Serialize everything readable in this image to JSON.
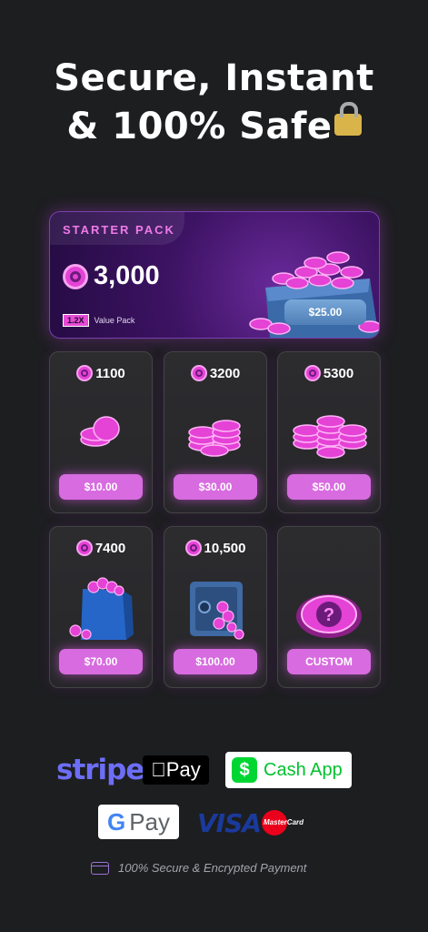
{
  "hero": {
    "line1": "Secure, Instant",
    "line2": "& 100% Safe"
  },
  "starter_pack": {
    "title": "STARTER PACK",
    "amount": "3,000",
    "multiplier": "1.2X",
    "badge_label": "Value Pack",
    "price": "$25.00"
  },
  "packs": [
    {
      "amount": "1100",
      "price": "$10.00",
      "art": "coin-pile-small-icon"
    },
    {
      "amount": "3200",
      "price": "$30.00",
      "art": "coin-pile-medium-icon"
    },
    {
      "amount": "5300",
      "price": "$50.00",
      "art": "coin-pile-large-icon"
    },
    {
      "amount": "7400",
      "price": "$70.00",
      "art": "shopping-bag-icon"
    },
    {
      "amount": "10,500",
      "price": "$100.00",
      "art": "safe-vault-icon"
    },
    {
      "amount": "",
      "price": "CUSTOM",
      "art": "question-coin-icon"
    }
  ],
  "payments": {
    "stripe": "stripe",
    "apple_pay": "Pay",
    "cash_app": "Cash App",
    "google_pay": "Pay",
    "visa": "VISA",
    "mastercard": "MasterCard"
  },
  "footer": {
    "secure_text": "100% Secure & Encrypted Payment"
  },
  "colors": {
    "accent": "#d86be0",
    "coin": "#e542d6",
    "background": "#1d1e20"
  }
}
